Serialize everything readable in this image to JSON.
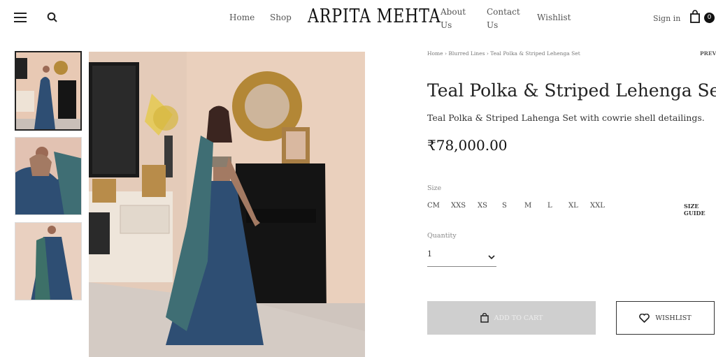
{
  "header": {
    "logo": "ARPITA MEHTA",
    "nav": [
      {
        "label": "Home"
      },
      {
        "label": "Shop"
      },
      {
        "label": "About\nUs"
      },
      {
        "label": "Contact\nUs"
      },
      {
        "label": "Wishlist"
      }
    ],
    "signin_label": "Sign in",
    "cart_count": "0"
  },
  "breadcrumb": {
    "items": [
      "Home",
      "Blurred Lines",
      "Teal Polka & Striped Lehenga Set"
    ],
    "separator": "›",
    "prev_label": "PREV"
  },
  "product": {
    "title": "Teal Polka & Striped Lehenga Set",
    "description": "Teal Polka & Striped Lahenga Set with cowrie shell detailings.",
    "price": "₹78,000.00",
    "size_label": "Size",
    "sizes": [
      "CM",
      "XXS",
      "XS",
      "S",
      "M",
      "L",
      "XL",
      "XXL"
    ],
    "size_guide_label": "SIZE GUIDE",
    "quantity_label": "Quantity",
    "quantity_value": "1",
    "add_to_cart_label": "ADD TO CART",
    "wishlist_label": "WISHLIST"
  },
  "colors": {
    "wall": "#e8c9b4",
    "lehenga": "#2e4e73",
    "piano": "#141414",
    "floor": "#c9bfb8",
    "button_disabled": "#cfcfcf"
  }
}
